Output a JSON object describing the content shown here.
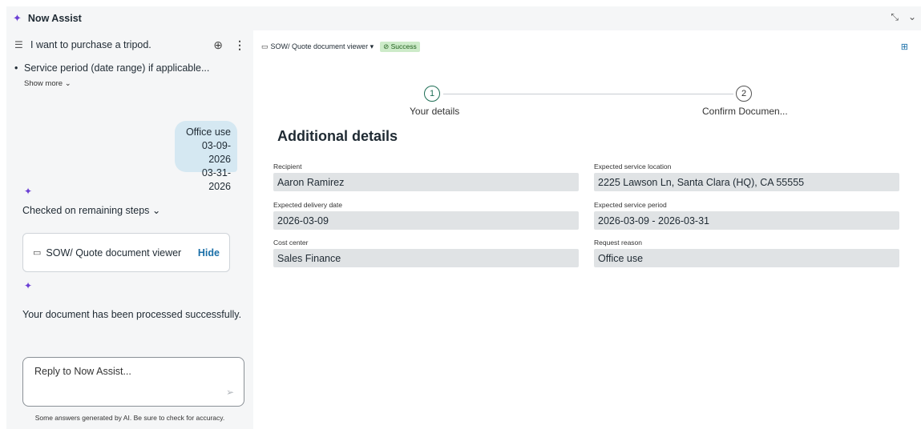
{
  "app": {
    "title": "Now Assist"
  },
  "conversation": {
    "title": "I want to purchase a tripod.",
    "bullet": "Service period (date range) if applicable...",
    "show_more": "Show more",
    "user_message": [
      "Office use",
      "03-09-2026",
      "03-31-2026"
    ],
    "checked_steps": "Checked on remaining steps",
    "doc_card": {
      "title": "SOW/ Quote document viewer",
      "hide_label": "Hide"
    },
    "processed_msg": "Your document has been processed successfully.",
    "reply_placeholder": "Reply to Now Assist...",
    "disclaimer": "Some answers generated by AI. Be sure to check for accuracy."
  },
  "viewer": {
    "title": "SOW/ Quote document viewer",
    "status": "Success",
    "steps": [
      {
        "number": "1",
        "label": "Your details"
      },
      {
        "number": "2",
        "label": "Confirm Documen..."
      }
    ],
    "section_title": "Additional details",
    "fields": {
      "recipient": {
        "label": "Recipient",
        "value": "Aaron Ramirez"
      },
      "location": {
        "label": "Expected service location",
        "value": "2225 Lawson Ln, Santa Clara (HQ), CA 55555"
      },
      "delivery": {
        "label": "Expected delivery date",
        "value": "2026-03-09"
      },
      "period": {
        "label": "Expected service period",
        "value": "2026-03-09 - 2026-03-31"
      },
      "cost": {
        "label": "Cost center",
        "value": "Sales Finance"
      },
      "reason": {
        "label": "Request reason",
        "value": "Office use"
      }
    }
  },
  "colors": {
    "accent": "#6b3fd4",
    "link": "#1a6fa8",
    "success_bg": "#cdebc9",
    "step_active": "#1e6e55"
  }
}
